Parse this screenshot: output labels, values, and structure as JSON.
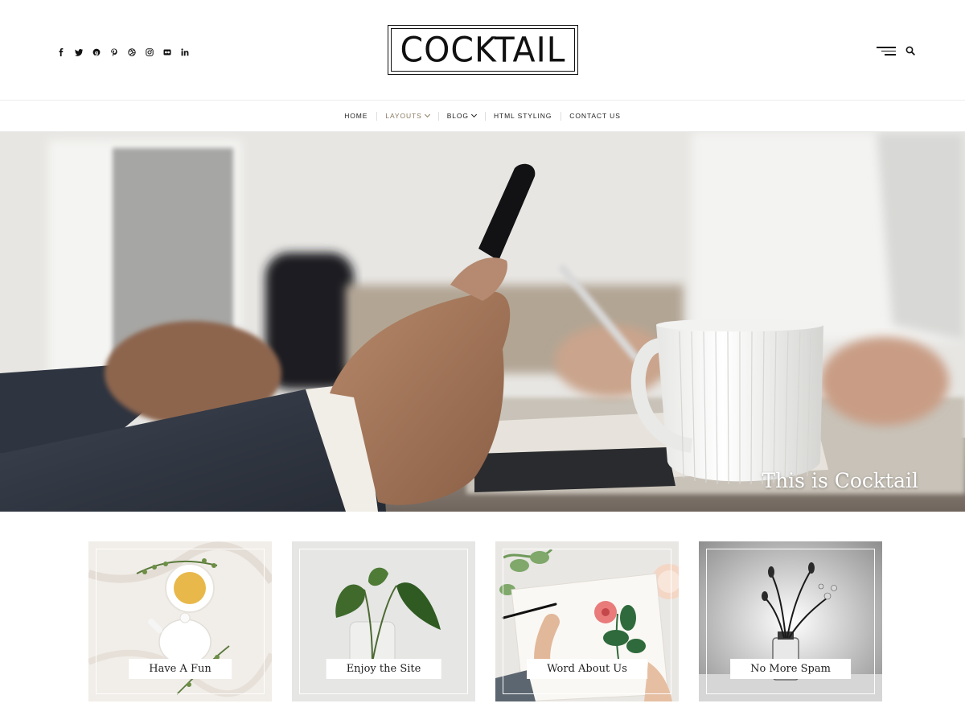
{
  "header": {
    "logo_text": "COCKTAIL",
    "social_icons": [
      {
        "name": "facebook-icon",
        "glyph": "f"
      },
      {
        "name": "twitter-icon",
        "glyph": "t"
      },
      {
        "name": "google-plus-icon",
        "glyph": "g"
      },
      {
        "name": "pinterest-icon",
        "glyph": "p"
      },
      {
        "name": "dribbble-icon",
        "glyph": "d"
      },
      {
        "name": "instagram-icon",
        "glyph": "i"
      },
      {
        "name": "flickr-icon",
        "glyph": "fl"
      },
      {
        "name": "linkedin-icon",
        "glyph": "in"
      }
    ],
    "tools": [
      "hamburger-menu-icon",
      "search-icon"
    ]
  },
  "nav": {
    "items": [
      {
        "label": "HOME",
        "dropdown": false,
        "active": false
      },
      {
        "label": "LAYOUTS",
        "dropdown": true,
        "active": true
      },
      {
        "label": "BLOG",
        "dropdown": true,
        "active": false
      },
      {
        "label": "HTML STYLING",
        "dropdown": false,
        "active": false
      },
      {
        "label": "CONTACT US",
        "dropdown": false,
        "active": false
      }
    ],
    "active_color": "#8a7a60"
  },
  "hero": {
    "caption": "This is Cocktail"
  },
  "cards": [
    {
      "label": "Have A Fun"
    },
    {
      "label": "Enjoy the Site"
    },
    {
      "label": "Word About Us"
    },
    {
      "label": "No More Spam"
    }
  ]
}
